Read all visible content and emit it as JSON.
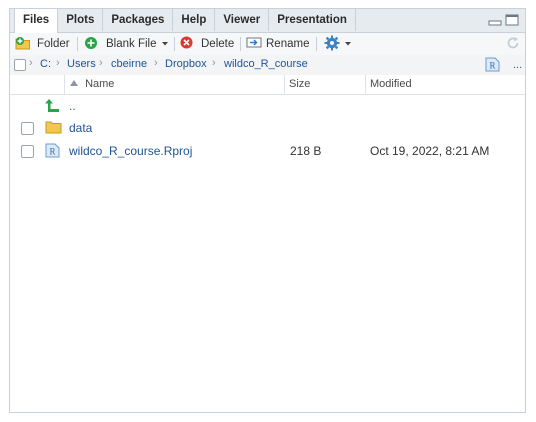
{
  "tabs": [
    {
      "label": "Files",
      "active": true
    },
    {
      "label": "Plots",
      "active": false
    },
    {
      "label": "Packages",
      "active": false
    },
    {
      "label": "Help",
      "active": false
    },
    {
      "label": "Viewer",
      "active": false
    },
    {
      "label": "Presentation",
      "active": false
    }
  ],
  "toolbar": {
    "new_folder": "Folder",
    "blank_file": "Blank File",
    "delete": "Delete",
    "rename": "Rename",
    "more_icon": "gear-icon",
    "refresh_icon": "refresh-icon"
  },
  "breadcrumb": [
    "C:",
    "Users",
    "cbeirne",
    "Dropbox",
    "wildco_R_course"
  ],
  "breadcrumb_more": "...",
  "columns": {
    "name": "Name",
    "size": "Size",
    "modified": "Modified"
  },
  "files": [
    {
      "name": "..",
      "type": "parent",
      "size": "",
      "modified": ""
    },
    {
      "name": "data",
      "type": "folder",
      "size": "",
      "modified": ""
    },
    {
      "name": "wildco_R_course.Rproj",
      "type": "rproj",
      "size": "218 B",
      "modified": "Oct 19, 2022, 8:21 AM"
    }
  ],
  "colors": {
    "accent": "#1f5496",
    "tab_bg": "#e6ebf0",
    "border": "#c9d0d8"
  }
}
